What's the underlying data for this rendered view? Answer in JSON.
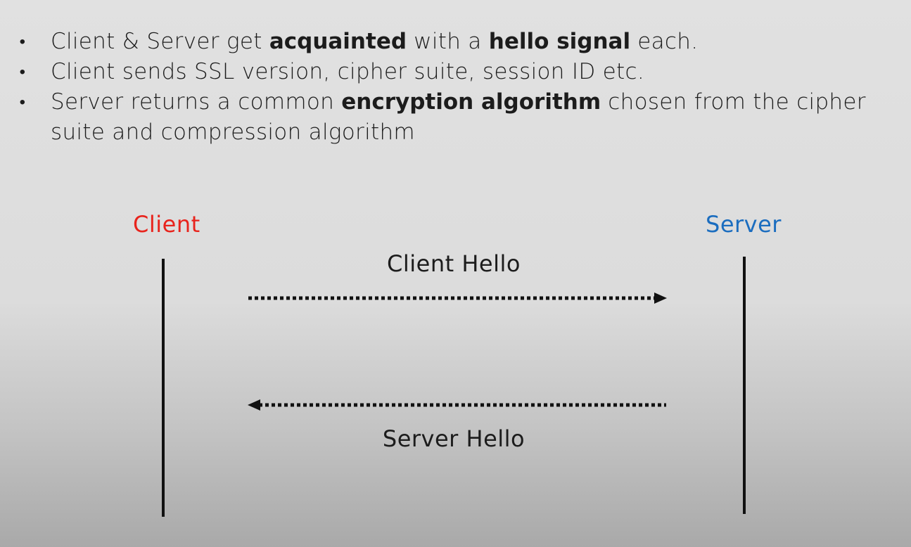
{
  "bullets": [
    {
      "segments": [
        {
          "text": "Client & Server get ",
          "bold": false
        },
        {
          "text": "acquainted",
          "bold": true
        },
        {
          "text": " with a ",
          "bold": false
        },
        {
          "text": "hello signal",
          "bold": true
        },
        {
          "text": " each.",
          "bold": false
        }
      ]
    },
    {
      "segments": [
        {
          "text": "Client sends SSL version, cipher suite, session ID etc.",
          "bold": false
        }
      ]
    },
    {
      "segments": [
        {
          "text": "Server returns a common ",
          "bold": false
        },
        {
          "text": "encryption algorithm",
          "bold": true
        },
        {
          "text": " chosen from the cipher suite and compression algorithm",
          "bold": false
        }
      ]
    }
  ],
  "diagram": {
    "client_label": "Client",
    "server_label": "Server",
    "client_color": "#e8231c",
    "server_color": "#1b6dbf",
    "messages": [
      {
        "label": "Client Hello",
        "direction": "client-to-server",
        "style": "dotted"
      },
      {
        "label": "Server Hello",
        "direction": "server-to-client",
        "style": "dotted"
      }
    ]
  }
}
